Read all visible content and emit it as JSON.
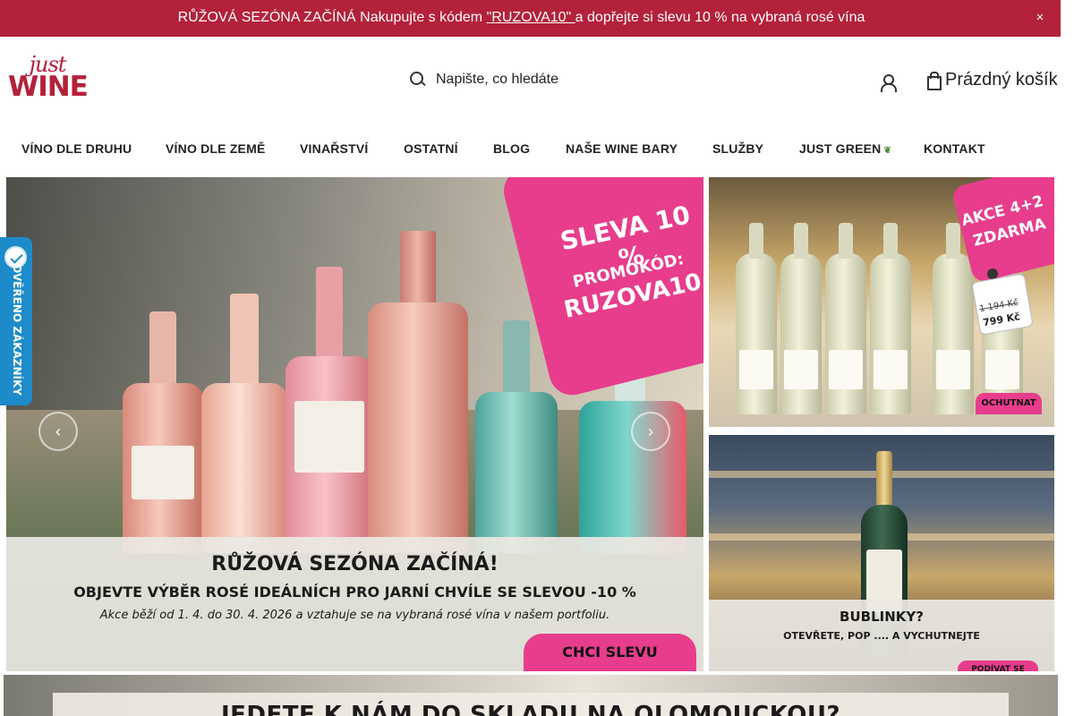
{
  "promo": {
    "text_before": "RŮŽOVÁ SEZÓNA ZAČÍNÁ Nakupujte s kódem ",
    "code": "\"RUZOVA10\" ",
    "text_after": "a dopřejte si slevu 10 % na vybraná rosé vína",
    "close_icon": "close-icon",
    "background": "#b3213a"
  },
  "header": {
    "logo_line1": "just",
    "logo_line2": "WINE",
    "search_placeholder": "Napište, co hledáte",
    "cart_label": "Prázdný košík"
  },
  "nav": {
    "items": [
      {
        "label": "VÍNO DLE DRUHU"
      },
      {
        "label": "VÍNO DLE ZEMĚ"
      },
      {
        "label": "VINAŘSTVÍ"
      },
      {
        "label": "OSTATNÍ"
      },
      {
        "label": "BLOG"
      },
      {
        "label": "NAŠE WINE BARY"
      },
      {
        "label": "SLUŽBY"
      },
      {
        "label": "JUST GREEN"
      },
      {
        "label": "KONTAKT"
      }
    ]
  },
  "hero": {
    "badge_line1": "SLEVA 10 %",
    "badge_line2": "PROMOKÓD:",
    "badge_line3": "RUZOVA10",
    "headline": "RŮŽOVÁ SEZÓNA ZAČÍNÁ!",
    "subheadline": "OBJEVTE VÝBĚR ROSÉ IDEÁLNÍCH PRO JARNÍ CHVÍLE SE SLEVOU -10 %",
    "note": "Akce běží od 1. 4. do 30. 4. 2026 a vztahuje se na vybraná rosé vína v našem portfoliu.",
    "cta": "CHCI SLEVU",
    "prev_icon": "chevron-left-icon",
    "next_icon": "chevron-right-icon"
  },
  "side_top": {
    "badge_line1": "AKCE 4+2",
    "badge_line2": "ZDARMA",
    "old_price": "1 194 Kč",
    "new_price": "799 Kč",
    "cta": "OCHUTNAT"
  },
  "side_bottom": {
    "headline": "BUBLINKY?",
    "subheadline": "OTEVŘETE, POP .... A VYCHUTNEJTE",
    "cta": "PODÍVAT SE"
  },
  "wide_banner": {
    "headline": "JEDETE K NÁM DO SKLADU NA OLOMOUCKOU?"
  },
  "verified_tab": {
    "label": "OVĚŘENO ZÁKAZNÍKY",
    "color": "#1d8bc9"
  },
  "colors": {
    "brand": "#b3213a",
    "accent_pink": "#e73d8c"
  }
}
